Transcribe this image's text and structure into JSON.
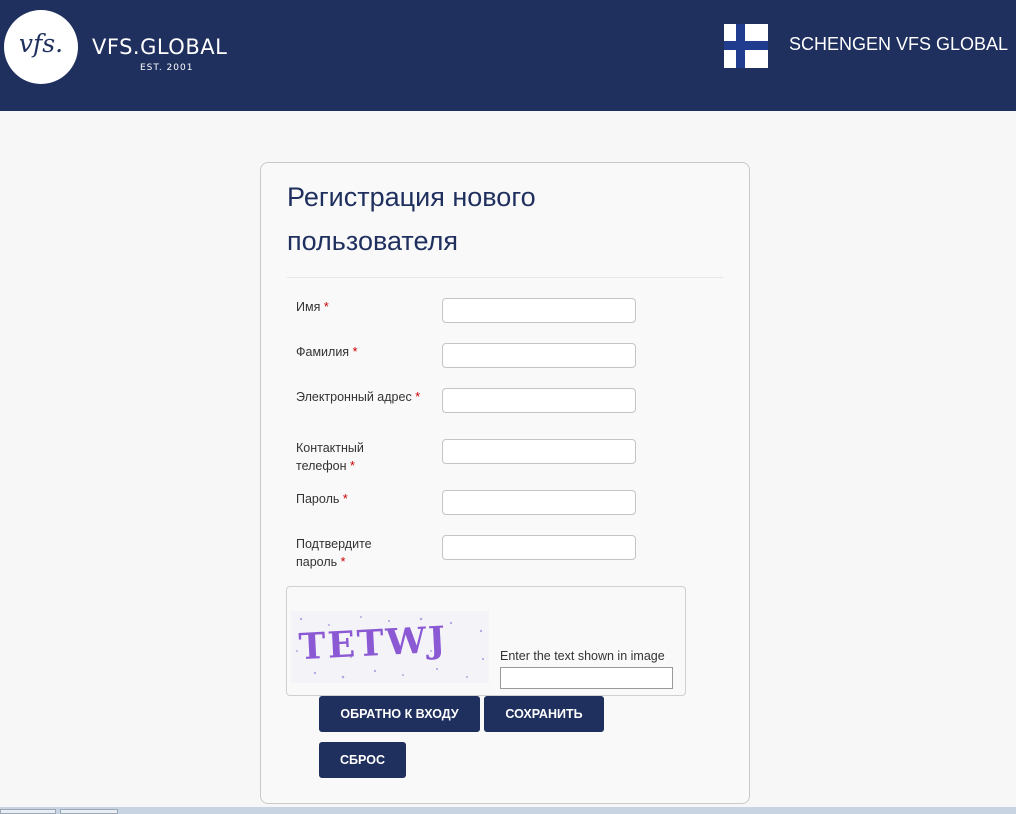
{
  "header": {
    "logo_mark": "vfs.",
    "brand_name": "VFS.GLOBAL",
    "brand_est": "EST. 2001",
    "title": "SCHENGEN VFS GLOBAL",
    "flag_icon": "finland-flag-icon",
    "colors": {
      "bar": "#1f2f5e",
      "flag_cross": "#1f3c8f"
    }
  },
  "form": {
    "title": "Регистрация нового пользователя",
    "required_marker": "*",
    "fields": [
      {
        "label": "Имя",
        "value": "",
        "placeholder": ""
      },
      {
        "label": "Фамилия",
        "value": "",
        "placeholder": ""
      },
      {
        "label": "Электронный адрес",
        "value": "",
        "placeholder": ""
      },
      {
        "label": "Контактный телефон",
        "value": "",
        "placeholder": ""
      },
      {
        "label": "Пароль",
        "value": "",
        "placeholder": ""
      },
      {
        "label": "Подтвердите пароль",
        "value": "",
        "placeholder": ""
      }
    ],
    "captcha": {
      "image_text": "TETWJ",
      "label": "Enter the text shown in image",
      "value": ""
    },
    "buttons": {
      "back": "ОБРАТНО К ВХОДУ",
      "save": "СОХРАНИТЬ",
      "reset": "СБРОС"
    }
  }
}
